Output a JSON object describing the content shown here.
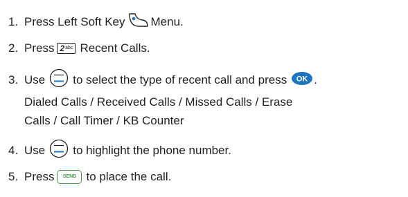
{
  "steps": [
    {
      "num": "1.",
      "before": "Press Left Soft Key",
      "after": "Menu."
    },
    {
      "num": "2.",
      "before": "Press",
      "key": "2",
      "key_sub": "abc",
      "after": "Recent Calls."
    },
    {
      "num": "3.",
      "before": "Use",
      "after": "to select the type of recent call and press",
      "ok_label": "OK",
      "end": "."
    },
    {
      "num": "4.",
      "before": "Use",
      "after": "to highlight the phone number."
    },
    {
      "num": "5.",
      "before": "Press",
      "send_label": "SEND",
      "after": "to place the call."
    }
  ],
  "call_types_line1": "Dialed Calls / Received Calls / Missed Calls / Erase",
  "call_types_line2": "Calls / Call Timer / KB Counter",
  "icons": {
    "left_soft_key": "left-soft-key-icon",
    "nav_key": "navigation-key-icon",
    "ok_key": "ok-key-icon",
    "send_key": "send-key-icon"
  },
  "colors": {
    "text": "#231f20",
    "accent_blue": "#1c75bc",
    "accent_green": "#3d9a49"
  }
}
